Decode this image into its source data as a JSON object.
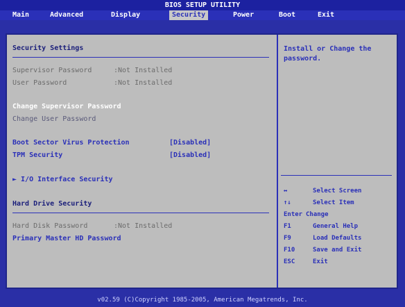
{
  "title": "BIOS SETUP UTILITY",
  "menu": [
    "Main",
    "Advanced",
    "Display",
    "Security",
    "Power",
    "Boot",
    "Exit"
  ],
  "left": {
    "section_title": "Security Settings",
    "supervisor_password": {
      "label": "Supervisor Password",
      "value": ":Not Installed"
    },
    "user_password": {
      "label": "User Password",
      "value": ":Not Installed"
    },
    "change_supervisor": "Change Supervisor Password",
    "change_user": "Change User Password",
    "boot_sector": {
      "label": "Boot Sector Virus Protection",
      "value": "[Disabled]"
    },
    "tpm": {
      "label": "TPM Security",
      "value": "[Disabled]"
    },
    "io_interface": "► I/O Interface Security",
    "hdd_title": "Hard Drive Security",
    "hdd_password": {
      "label": "Hard Disk Password",
      "value": ":Not Installed"
    },
    "primary_master": "Primary Master HD Password"
  },
  "right": {
    "help_text": "Install or Change the password.",
    "keys": [
      {
        "key": "↔",
        "desc": "Select Screen"
      },
      {
        "key": "↑↓",
        "desc": "Select Item"
      },
      {
        "key": "Enter",
        "desc": "Change"
      },
      {
        "key": "F1",
        "desc": "General Help"
      },
      {
        "key": "F9",
        "desc": "Load Defaults"
      },
      {
        "key": "F10",
        "desc": "Save and Exit"
      },
      {
        "key": "ESC",
        "desc": "Exit"
      }
    ]
  },
  "footer": "v02.59 (C)Copyright 1985-2005, American Megatrends, Inc."
}
